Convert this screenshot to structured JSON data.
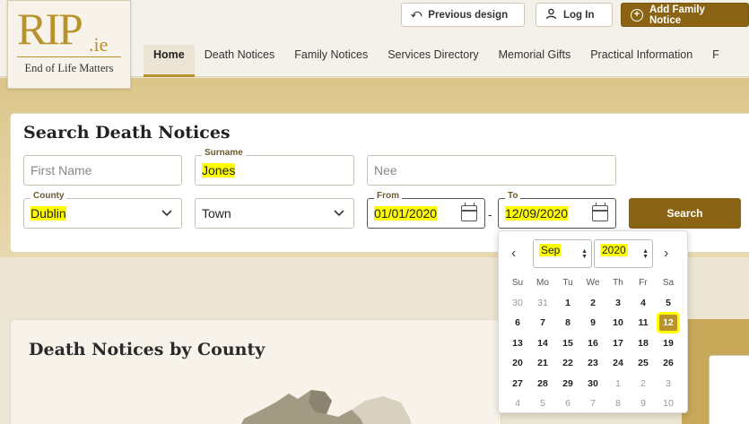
{
  "logo": {
    "brand": "RIP",
    "tld": ".ie",
    "tagline": "End of Life Matters"
  },
  "topbar": {
    "previous_design": "Previous design",
    "login": "Log In",
    "add_family_notice": "Add Family Notice"
  },
  "nav": {
    "items": [
      "Home",
      "Death Notices",
      "Family Notices",
      "Services Directory",
      "Memorial Gifts",
      "Practical Information",
      "F"
    ]
  },
  "search": {
    "title": "Search Death Notices",
    "first_name_placeholder": "First Name",
    "surname_label": "Surname",
    "surname_value": "Jones",
    "nee_placeholder": "Nee",
    "county_label": "County",
    "county_value": "Dublin",
    "town_value": "Town",
    "from_label": "From",
    "from_value": "01/01/2020",
    "to_label": "To",
    "to_value": "12/09/2020",
    "search_button": "Search"
  },
  "datepicker": {
    "month": "Sep",
    "year": "2020",
    "weekdays": [
      "Su",
      "Mo",
      "Tu",
      "We",
      "Th",
      "Fr",
      "Sa"
    ],
    "weeks": [
      [
        "30",
        "31",
        "1",
        "2",
        "3",
        "4",
        "5"
      ],
      [
        "6",
        "7",
        "8",
        "9",
        "10",
        "11",
        "12"
      ],
      [
        "13",
        "14",
        "15",
        "16",
        "17",
        "18",
        "19"
      ],
      [
        "20",
        "21",
        "22",
        "23",
        "24",
        "25",
        "26"
      ],
      [
        "27",
        "28",
        "29",
        "30",
        "1",
        "2",
        "3"
      ],
      [
        "4",
        "5",
        "6",
        "7",
        "8",
        "9",
        "10"
      ]
    ],
    "selected": "12"
  },
  "county_section": {
    "title": "Death Notices by County"
  },
  "colors": {
    "accent": "#8a6414",
    "gold": "#b8922c",
    "highlight": "#ffff00"
  }
}
